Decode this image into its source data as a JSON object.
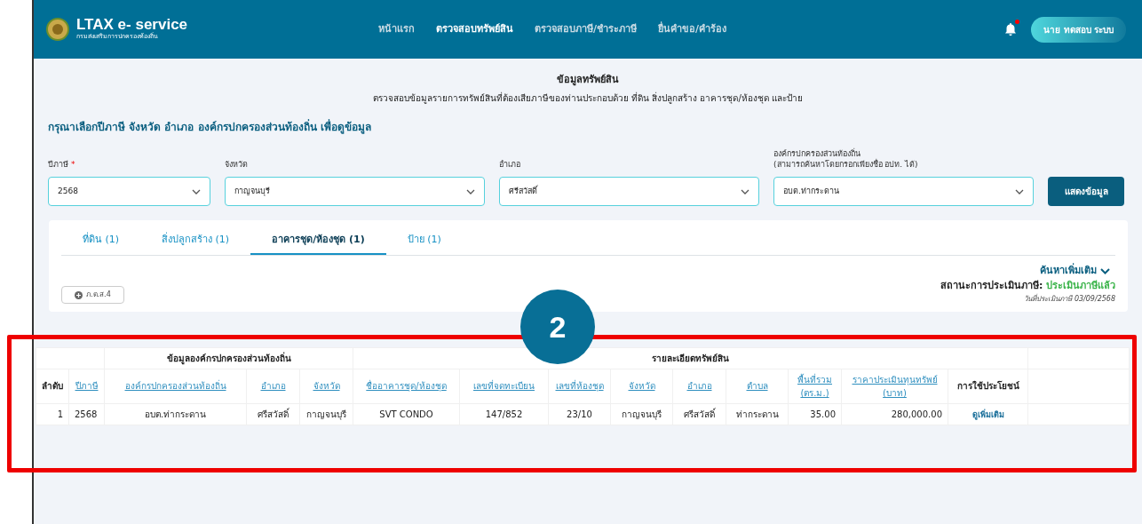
{
  "header": {
    "logo_title": "LTAX e- service",
    "logo_subtitle": "กรมส่งเสริมการปกครองท้องถิ่น",
    "nav": [
      {
        "label": "หน้าแรก",
        "selected": false
      },
      {
        "label": "ตรวจสอบทรัพย์สิน",
        "selected": true
      },
      {
        "label": "ตรวจสอบภาษี/ชำระภาษี",
        "selected": false
      },
      {
        "label": "ยื่นคำขอ/คำร้อง",
        "selected": false
      }
    ],
    "notification_dot": true,
    "user_button": "นาย ทดสอบ ระบบ"
  },
  "page": {
    "title": "ข้อมูลทรัพย์สิน",
    "subtitle": "ตรวจสอบข้อมูลรายการทรัพย์สินที่ต้องเสียภาษีของท่านประกอบด้วย ที่ดิน สิ่งปลูกสร้าง อาคารชุด/ห้องชุด และป้าย",
    "instruction": "กรุณาเลือกปีภาษี จังหวัด อำเภอ องค์กรปกครองส่วนท้องถิ่น เพื่อดูข้อมูล"
  },
  "filters": [
    {
      "label": "ปีภาษี",
      "required_mark": "*",
      "value": "2568"
    },
    {
      "label": "จังหวัด",
      "value": "กาญจนบุรี"
    },
    {
      "label": "อำเภอ",
      "value": "ศรีสวัสดิ์"
    },
    {
      "label": "องค์กรปกครองส่วนท้องถิ่น",
      "hint": "(สามารถค้นหาโดยกรอกเพียงชื่อ อปท. ได้)",
      "value": "อบต.ท่ากระดาน"
    }
  ],
  "show_button": "แสดงข้อมูล",
  "tabs": [
    {
      "label": "ที่ดิน (1)",
      "selected": false
    },
    {
      "label": "สิ่งปลูกสร้าง (1)",
      "selected": false
    },
    {
      "label": "อาคารชุด/ห้องชุด (1)",
      "selected": true
    },
    {
      "label": "ป้าย (1)",
      "selected": false
    }
  ],
  "more_search": "ค้นหาเพิ่มเติม",
  "form_button": "ภ.ด.ส.4",
  "status": {
    "label": "สถานะการประเมินภาษี:",
    "value": "ประเมินภาษีแล้ว",
    "date": "วันที่ประเมินภาษี 03/09/2568"
  },
  "table": {
    "column_groups": [
      {
        "columns": [
          {
            "label": "ลำดับ",
            "sortable": false
          },
          {
            "label": "ปีภาษี",
            "sortable": true
          }
        ]
      },
      {
        "title": "ข้อมูลองค์กรปกครองส่วนท้องถิ่น",
        "columns": [
          {
            "label": "องค์กรปกครองส่วนท้องถิ่น",
            "sortable": true
          },
          {
            "label": "อำเภอ",
            "sortable": true
          },
          {
            "label": "จังหวัด",
            "sortable": true
          }
        ]
      },
      {
        "title": "รายละเอียดทรัพย์สิน",
        "columns": [
          {
            "label": "ชื่ออาคารชุด/ห้องชุด",
            "sortable": true
          },
          {
            "label": "เลขที่จดทะเบียน",
            "sortable": true
          },
          {
            "label": "เลขที่ห้องชุด",
            "sortable": true
          },
          {
            "label": "จังหวัด",
            "sortable": true
          },
          {
            "label": "อำเภอ",
            "sortable": true
          },
          {
            "label": "ตำบล",
            "sortable": true
          },
          {
            "label": "พื้นที่รวม (ตร.ม.)",
            "sortable": true
          },
          {
            "label": "ราคาประเมินทุนทรัพย์ (บาท)",
            "sortable": true
          },
          {
            "label": "การใช้ประโยชน์",
            "sortable": false
          }
        ]
      }
    ],
    "rows": [
      {
        "cells": [
          "1",
          "2568",
          "อบต.ท่ากระดาน",
          "ศรีสวัสดิ์",
          "กาญจนบุรี",
          "SVT CONDO",
          "147/852",
          "23/10",
          "กาญจนบุรี",
          "ศรีสวัสดิ์",
          "ท่ากระดาน",
          "35.00",
          "280,000.00"
        ],
        "action": "ดูเพิ่มเติม"
      }
    ]
  },
  "annotations": {
    "highlight_box": true,
    "step_number": "2"
  }
}
